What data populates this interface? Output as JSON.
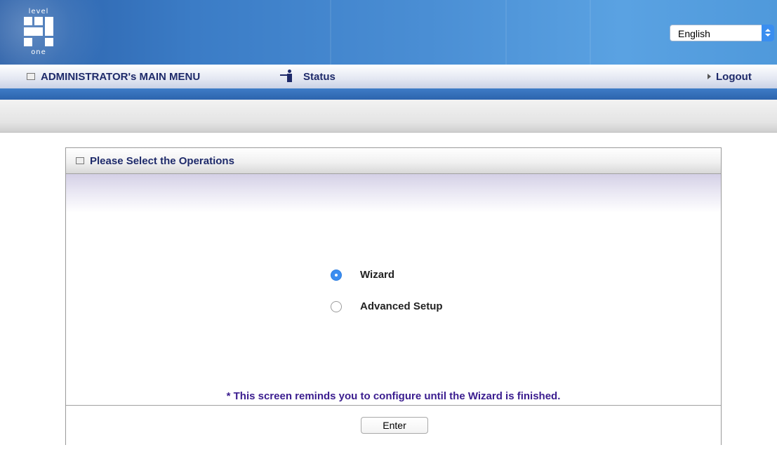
{
  "header": {
    "logo": {
      "top_text": "level",
      "bottom_text": "one"
    },
    "language": {
      "selected": "English"
    }
  },
  "menu": {
    "main_menu_label": "ADMINISTRATOR's MAIN MENU",
    "status_label": "Status",
    "logout_label": "Logout"
  },
  "panel": {
    "title": "Please Select the Operations",
    "options": [
      {
        "label": "Wizard",
        "selected": true
      },
      {
        "label": "Advanced Setup",
        "selected": false
      }
    ],
    "note": "* This screen reminds you to configure until the Wizard is finished.",
    "enter_label": "Enter"
  },
  "colors": {
    "menu_text": "#1e2a6a",
    "note_text": "#3b1d8f",
    "radio_selected": "#3b8df0"
  }
}
